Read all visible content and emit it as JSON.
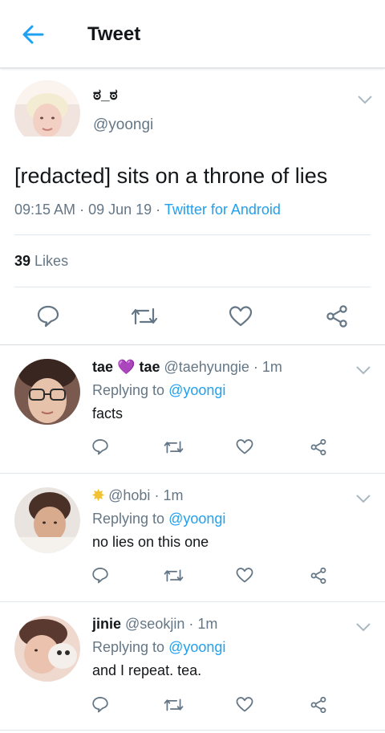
{
  "header": {
    "title": "Tweet"
  },
  "main_tweet": {
    "display_name": "ಠ_ಠ",
    "handle": "@yoongi",
    "text": "[redacted] sits on a throne of lies",
    "time": "09:15 AM",
    "date": "09 Jun 19",
    "source": "Twitter for Android",
    "likes_count": "39",
    "likes_label": "Likes"
  },
  "replies": [
    {
      "name_part1": "tae",
      "emoji": "💜",
      "name_part2": "tae",
      "handle": "@taehyungie",
      "age": "1m",
      "replying_label": "Replying to",
      "replying_to": "@yoongi",
      "text": "facts"
    },
    {
      "name_emoji": "✸",
      "handle": "@hobi",
      "age": "1m",
      "replying_label": "Replying to",
      "replying_to": "@yoongi",
      "text": "no lies on this one"
    },
    {
      "name": "jinie",
      "handle": "@seokjin",
      "age": "1m",
      "replying_label": "Replying to",
      "replying_to": "@yoongi",
      "text": "and I repeat. tea."
    }
  ],
  "colors": {
    "accent": "#1da1f2",
    "muted": "#657786",
    "divider": "#e1e8ed",
    "emoji_purple": "#8e3fd1",
    "sun": "#f2c233"
  },
  "icons": [
    "back-arrow-icon",
    "chevron-down-icon",
    "reply-icon",
    "retweet-icon",
    "like-icon",
    "share-icon"
  ]
}
